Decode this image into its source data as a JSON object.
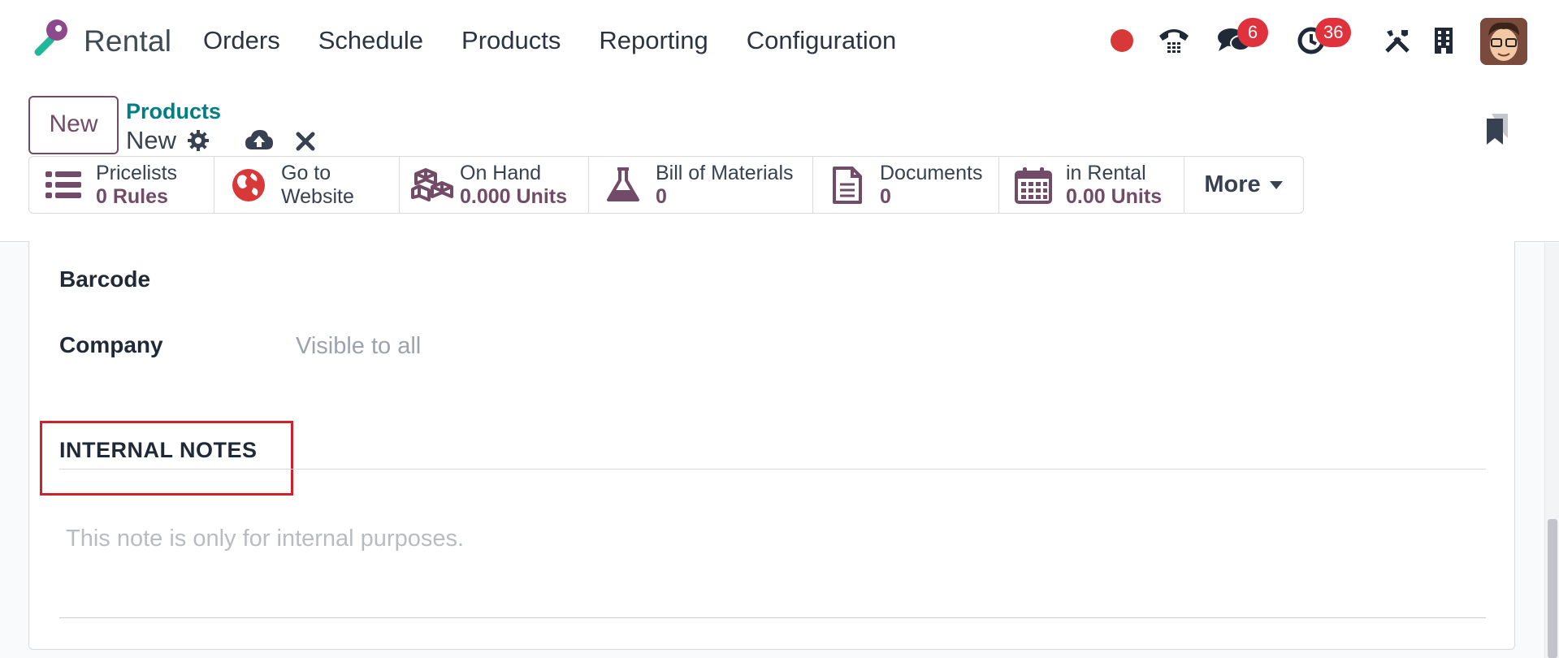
{
  "topbar": {
    "app_name": "Rental",
    "menu": [
      "Orders",
      "Schedule",
      "Products",
      "Reporting",
      "Configuration"
    ],
    "messages_badge": "6",
    "activities_badge": "36",
    "icons": [
      "recording-indicator-icon",
      "phone-icon",
      "chat-icon",
      "clock-icon",
      "tools-icon",
      "building-icon"
    ]
  },
  "control": {
    "new_label": "New",
    "breadcrumb": "Products",
    "record_name": "New"
  },
  "smart_buttons": [
    {
      "line1": "Pricelists",
      "line2": "0  Rules",
      "icon": "list-icon"
    },
    {
      "line1": "Go to",
      "line2": "Website",
      "icon": "globe-icon"
    },
    {
      "line1": "On Hand",
      "line2": "0.000 Units",
      "icon": "cubes-icon"
    },
    {
      "line1": "Bill of Materials",
      "line2": "0",
      "icon": "flask-icon"
    },
    {
      "line1": "Documents",
      "line2": "0",
      "icon": "document-icon"
    },
    {
      "line1": "in Rental",
      "line2": "0.00 Units",
      "icon": "calendar-icon"
    }
  ],
  "more_label": "More",
  "form": {
    "barcode_label": "Barcode",
    "company_label": "Company",
    "company_placeholder": "Visible to all",
    "internal_notes_title": "INTERNAL NOTES",
    "internal_notes_placeholder": "This note is only for internal purposes."
  },
  "colors": {
    "brand": "#714b67",
    "link": "#017e84",
    "badge": "#e0323c",
    "highlight": "#d0222b"
  }
}
